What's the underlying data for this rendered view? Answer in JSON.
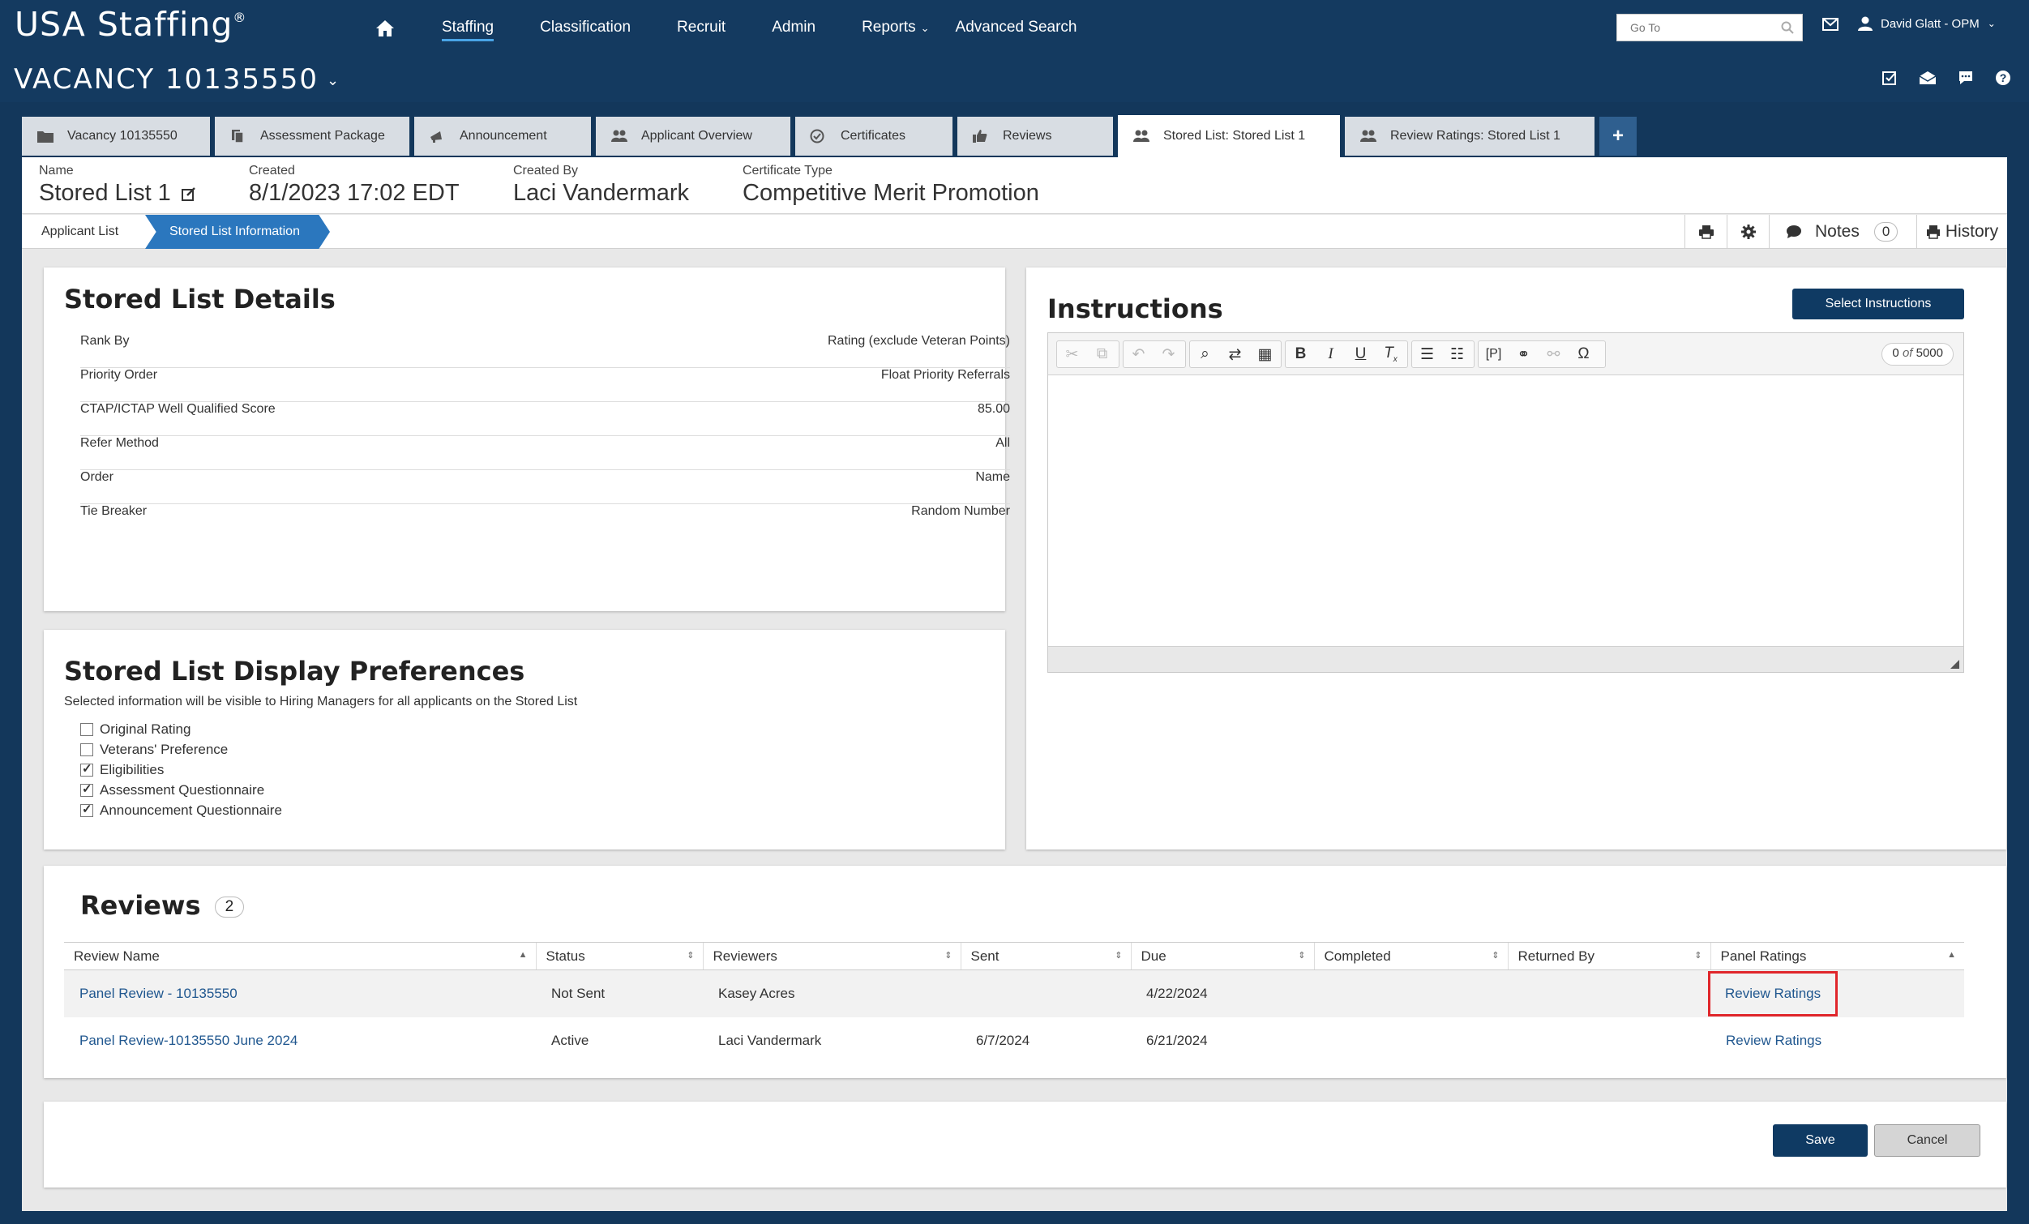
{
  "app": {
    "logo_text": "USA Staffing",
    "logo_mark": "®"
  },
  "nav": {
    "items": [
      "Staffing",
      "Classification",
      "Recruit",
      "Admin",
      "Reports",
      "Advanced Search"
    ],
    "active": "Staffing",
    "goto_placeholder": "Go To",
    "user_name": "David Glatt - OPM"
  },
  "vacancy": {
    "title": "VACANCY 10135550"
  },
  "tabs": [
    {
      "label": "Vacancy 10135550",
      "icon": "folder-icon"
    },
    {
      "label": "Assessment Package",
      "icon": "documents-icon"
    },
    {
      "label": "Announcement",
      "icon": "megaphone-icon"
    },
    {
      "label": "Applicant Overview",
      "icon": "people-icon"
    },
    {
      "label": "Certificates",
      "icon": "check-circle-icon"
    },
    {
      "label": "Reviews",
      "icon": "thumbs-up-icon"
    },
    {
      "label": "Stored List: Stored List 1",
      "icon": "people-icon",
      "active": true
    },
    {
      "label": "Review Ratings: Stored List 1",
      "icon": "people-icon"
    }
  ],
  "info": {
    "name_label": "Name",
    "name_value": "Stored List 1",
    "created_label": "Created",
    "created_value": "8/1/2023 17:02 EDT",
    "created_by_label": "Created By",
    "created_by_value": "Laci Vandermark",
    "cert_type_label": "Certificate Type",
    "cert_type_value": "Competitive Merit Promotion"
  },
  "breadcrumb": {
    "item1": "Applicant List",
    "item2": "Stored List Information"
  },
  "toolbar_right": {
    "notes_label": "Notes",
    "notes_count": "0",
    "history_label": "History"
  },
  "details": {
    "title": "Stored List Details",
    "rows": [
      {
        "label": "Rank By",
        "value": "Rating (exclude Veteran Points)"
      },
      {
        "label": "Priority Order",
        "value": "Float Priority Referrals"
      },
      {
        "label": "CTAP/ICTAP Well Qualified Score",
        "value": "85.00"
      },
      {
        "label": "Refer Method",
        "value": "All"
      },
      {
        "label": "Order",
        "value": "Name"
      },
      {
        "label": "Tie Breaker",
        "value": "Random Number"
      }
    ]
  },
  "preferences": {
    "title": "Stored List Display Preferences",
    "subtitle": "Selected information will be visible to Hiring Managers for all applicants on the Stored List",
    "options": [
      {
        "label": "Original Rating",
        "checked": false
      },
      {
        "label": "Veterans' Preference",
        "checked": false
      },
      {
        "label": "Eligibilities",
        "checked": true
      },
      {
        "label": "Assessment Questionnaire",
        "checked": true
      },
      {
        "label": "Announcement Questionnaire",
        "checked": true
      }
    ]
  },
  "instructions": {
    "title": "Instructions",
    "select_button": "Select Instructions",
    "counter_current": "0",
    "counter_of": "of",
    "counter_max": "5000"
  },
  "reviews": {
    "title": "Reviews",
    "count": "2",
    "columns": [
      "Review Name",
      "Status",
      "Reviewers",
      "Sent",
      "Due",
      "Completed",
      "Returned By",
      "Panel Ratings"
    ],
    "rows": [
      {
        "name": "Panel Review - 10135550",
        "status": "Not Sent",
        "reviewers": "Kasey Acres",
        "sent": "",
        "due": "4/22/2024",
        "completed": "",
        "returned_by": "",
        "panel": "Review Ratings"
      },
      {
        "name": "Panel Review-10135550 June 2024",
        "status": "Active",
        "reviewers": "Laci Vandermark",
        "sent": "6/7/2024",
        "due": "6/21/2024",
        "completed": "",
        "returned_by": "",
        "panel": "Review Ratings"
      }
    ]
  },
  "footer": {
    "save": "Save",
    "cancel": "Cancel"
  },
  "colors": {
    "header_bg": "#143a60",
    "primary_button": "#0f3a63",
    "breadcrumb_active": "#2b77be",
    "link": "#20578f",
    "highlight": "#e0262b"
  }
}
